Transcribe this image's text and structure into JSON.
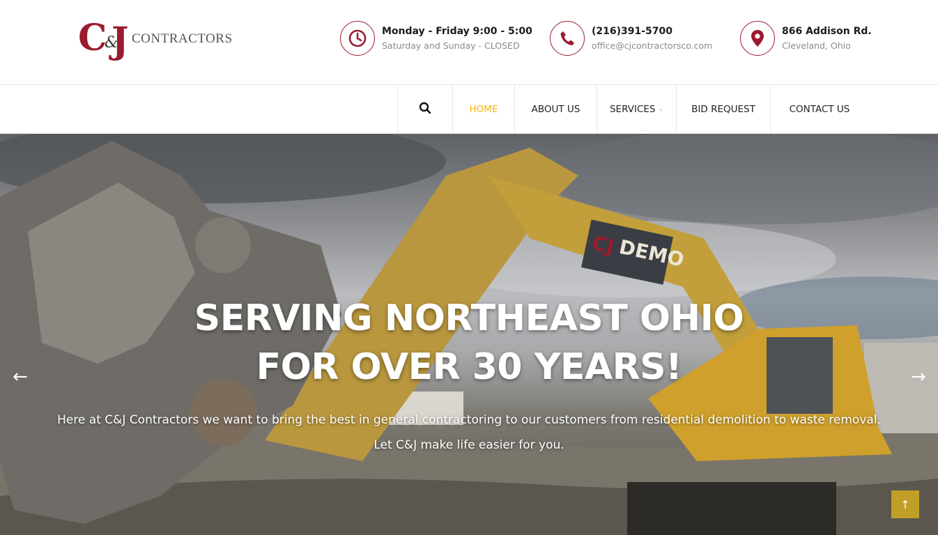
{
  "brand": {
    "logo_initial_c": "C",
    "logo_amp": "&",
    "logo_initial_j": "J",
    "logo_word": "CONTRACTORS",
    "accent_color": "#9b1b2e",
    "active_color": "#f2b705"
  },
  "header": {
    "hours": {
      "icon": "clock-icon",
      "line1": "Monday - Friday 9:00 - 5:00",
      "line2": "Saturday and Sunday - CLOSED"
    },
    "phone": {
      "icon": "phone-icon",
      "line1": "(216)391-5700",
      "line2": "office@cjcontractorsco.com"
    },
    "address": {
      "icon": "map-pin-icon",
      "line1": "866 Addison Rd.",
      "line2": "Cleveland, Ohio"
    }
  },
  "nav": {
    "search_icon": "search-icon",
    "home": "HOME",
    "about": "ABOUT US",
    "services": "SERVICES",
    "bid": "BID REQUEST",
    "contact": "CONTACT US"
  },
  "hero": {
    "title_line1": "SERVING NORTHEAST OHIO",
    "title_line2": "FOR OVER 30 YEARS!",
    "sub_line1": "Here at C&J Contractors we want to bring the best in general contractoring to our customers from residential demolition to waste removal.",
    "sub_line2": "Let C&J make life easier for you.",
    "machine_label": "DEMO",
    "machine_label_prefix": "CJ",
    "prev_arrow": "←",
    "next_arrow": "→",
    "to_top": "↑"
  }
}
